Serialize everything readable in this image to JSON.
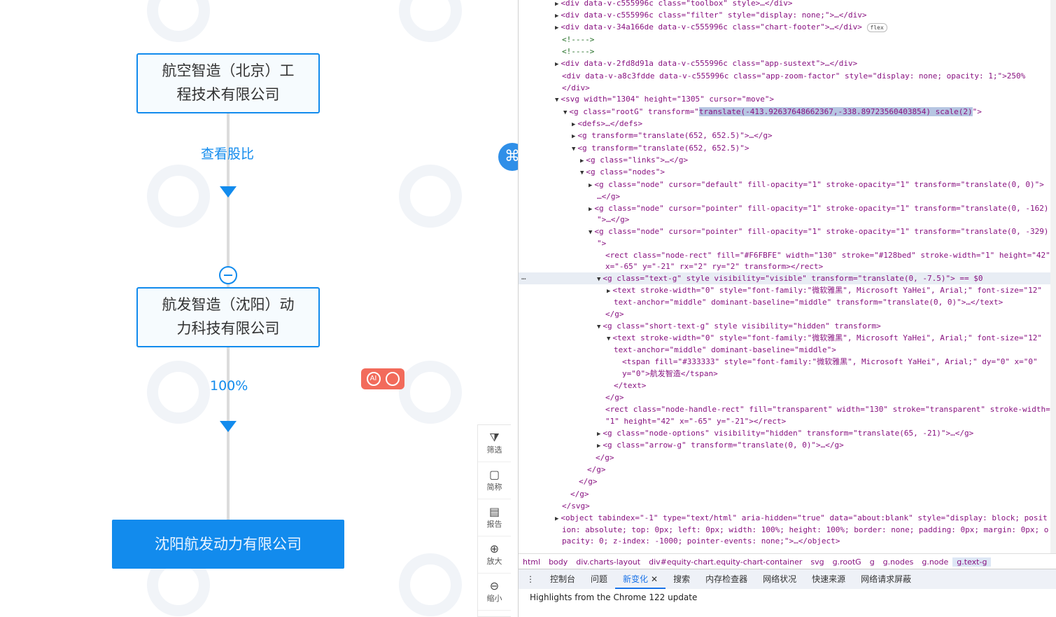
{
  "chart": {
    "node1": {
      "line1": "航空智造（北京）工",
      "line2": "程技术有限公司"
    },
    "edge1": {
      "label": "查看股比"
    },
    "node2": {
      "line1": "航发智造（沈阳）动",
      "line2": "力科技有限公司"
    },
    "edge2": {
      "label": "100%"
    },
    "node3": {
      "label": "沈阳航发动力有限公司"
    }
  },
  "toolbar": [
    {
      "icon": "filter-icon",
      "label": "筛选"
    },
    {
      "icon": "abbreviation-icon",
      "label": "简称"
    },
    {
      "icon": "report-icon",
      "label": "报告"
    },
    {
      "icon": "zoom-in-icon",
      "label": "放大"
    },
    {
      "icon": "zoom-out-icon",
      "label": "缩小"
    }
  ],
  "devtools": {
    "lines": [
      "<div data-v-c555996c class=\"toolbox\" style>…</div>",
      "<div data-v-c555996c class=\"filter\" style=\"display: none;\">…</div>",
      "<div data-v-34a166de data-v-c555996c class=\"chart-footer\">…</div>",
      "<!---->",
      "<!---->",
      "<div data-v-2fd8d91a data-v-c555996c class=\"app-sustext\">…</div>",
      "<div data-v-a8c3fdde data-v-c555996c class=\"app-zoom-factor\" style=\"display: none; opacity: 1;\">250%",
      "</div>",
      "<svg width=\"1304\" height=\"1305\" cursor=\"move\">",
      "<g class=\"rootG\" transform=\"",
      "<defs>…</defs>",
      "<g transform=\"translate(652, 652.5)\">…</g>",
      "<g transform=\"translate(652, 652.5)\">",
      "<g class=\"links\">…</g>",
      "<g class=\"nodes\">",
      "<g class=\"node\" cursor=\"default\" fill-opacity=\"1\" stroke-opacity=\"1\" transform=\"translate(0, 0)\">",
      "…</g>",
      "<g class=\"node\" cursor=\"pointer\" fill-opacity=\"1\" stroke-opacity=\"1\" transform=\"translate(0, -162)",
      "\">…</g>",
      "<g class=\"node\" cursor=\"pointer\" fill-opacity=\"1\" stroke-opacity=\"1\" transform=\"translate(0, -329)",
      "\">",
      "<rect class=\"node-rect\" fill=\"#F6FBFE\" width=\"130\" stroke=\"#128bed\" stroke-width=\"1\" height=\"42\"",
      "x=\"-65\" y=\"-21\" rx=\"2\" ry=\"2\" transform></rect>",
      "<g class=\"text-g\" style visibility=\"visible\" transform=\"translate(0, -7.5)\"> == $0",
      "<text stroke-width=\"0\" style=\"font-family:\"微软雅黑\", Microsoft YaHei\", Arial;\" font-size=\"12\"",
      "text-anchor=\"middle\" dominant-baseline=\"middle\" transform=\"translate(0, 0)\">…</text>",
      "</g>",
      "<g class=\"short-text-g\" style visibility=\"hidden\" transform>",
      "<text stroke-width=\"0\" style=\"font-family:\"微软雅黑\", Microsoft YaHei\", Arial;\" font-size=\"12\"",
      "text-anchor=\"middle\" dominant-baseline=\"middle\">",
      "<tspan fill=\"#333333\" style=\"font-family:\"微软雅黑\", Microsoft YaHei\", Arial;\" dy=\"0\" x=\"0\"",
      "y=\"0\">航发智造</tspan>",
      "</text>",
      "</g>",
      "<rect class=\"node-handle-rect\" fill=\"transparent\" width=\"130\" stroke=\"transparent\" stroke-width=",
      "\"1\" height=\"42\" x=\"-65\" y=\"-21\"></rect>",
      "<g class=\"node-options\" visibility=\"hidden\" transform=\"translate(65, -21)\">…</g>",
      "<g class=\"arrow-g\" transform=\"translate(0, 0)\">…</g>",
      "</g>",
      "</g>",
      "</g>",
      "</g>",
      "</svg>",
      "<object tabindex=\"-1\" type=\"text/html\" aria-hidden=\"true\" data=\"about:blank\" style=\"display: block; posit",
      "ion: absolute; top: 0px; left: 0px; width: 100%; height: 100%; border: none; padding: 0px; margin: 0px; o",
      "pacity: 0; z-index: -1000; pointer-events: none;\">…</object>"
    ],
    "highlight_value": "translate(-413.92637648662367,-338.89723560403854) scale(2)",
    "breadcrumbs": [
      "html",
      "body",
      "div.charts-layout",
      "div#equity-chart.equity-chart-container",
      "svg",
      "g.rootG",
      "g",
      "g.nodes",
      "g.node",
      "g.text-g"
    ],
    "tabs": [
      "控制台",
      "问题",
      "新变化",
      "搜索",
      "内存检查器",
      "网络状况",
      "快速来源",
      "网络请求屏蔽"
    ],
    "active_tab": "新变化",
    "notice": "Highlights from the Chrome 122 update",
    "flex_badge": "flex",
    "selected_marker": "…"
  },
  "colors": {
    "accent": "#128bed",
    "node_fill": "#F6FBFE",
    "badge": "#f26b5b"
  }
}
